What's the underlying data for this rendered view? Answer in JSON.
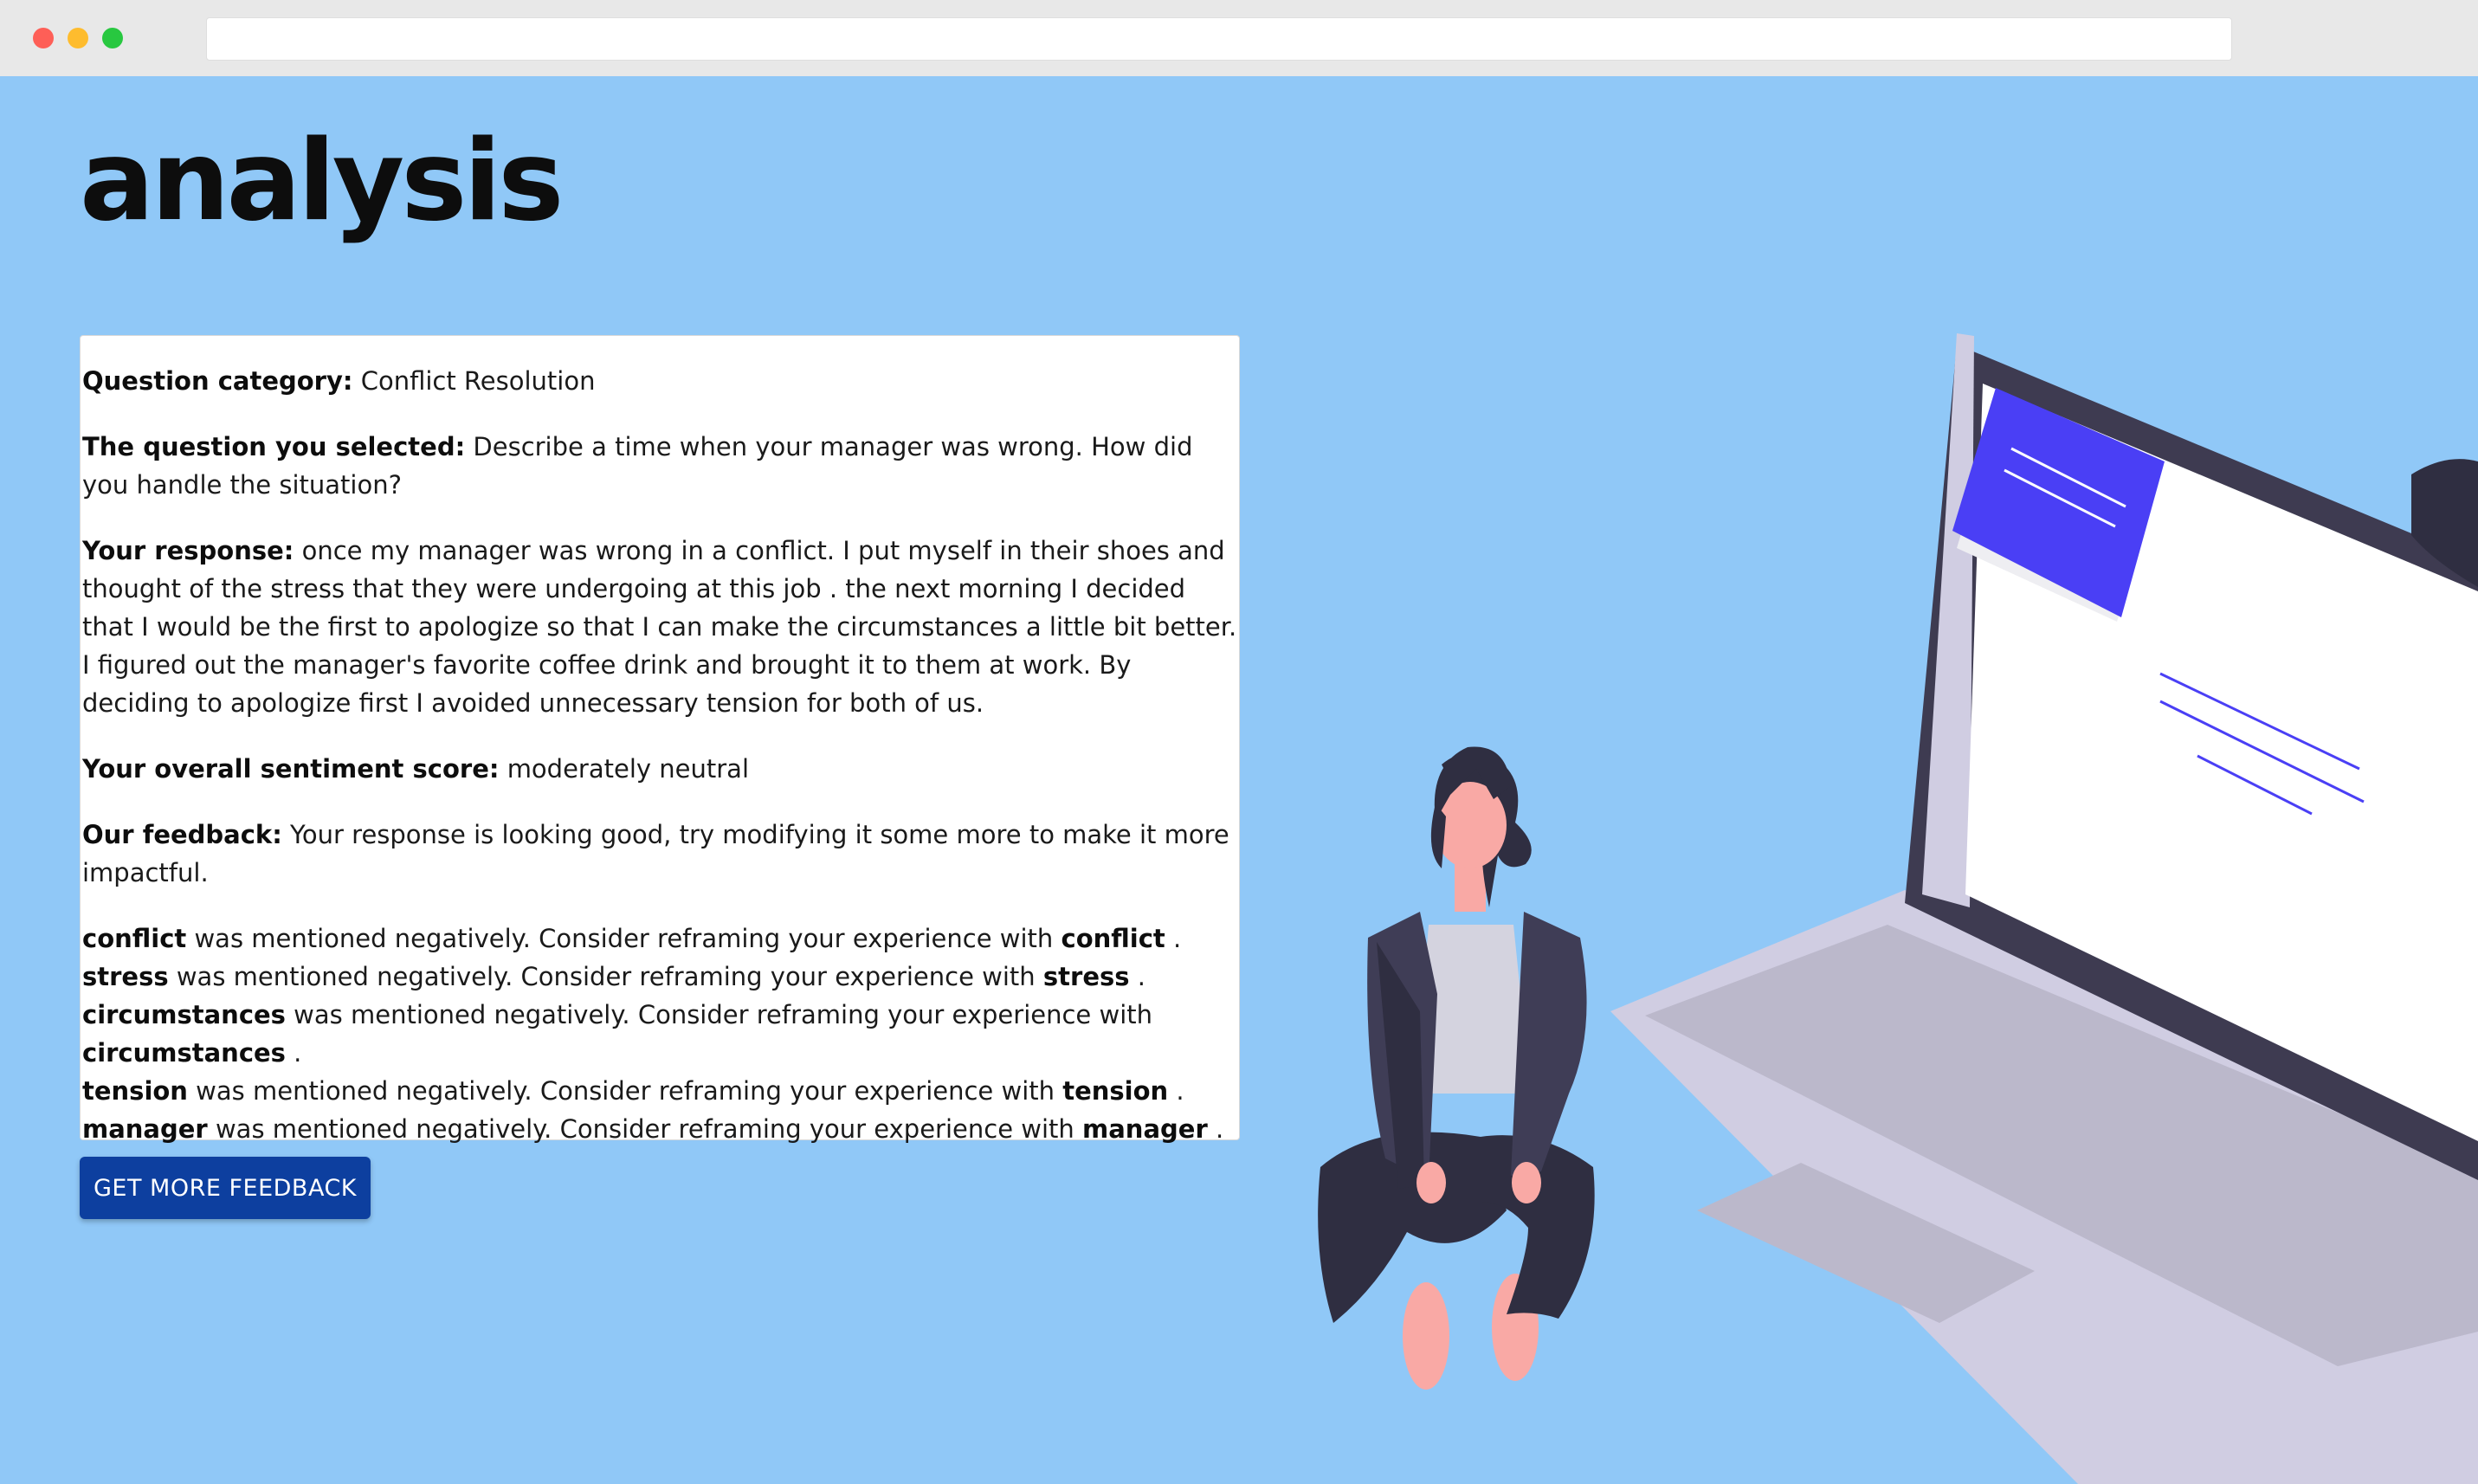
{
  "window": {
    "buttons": [
      "close",
      "minimize",
      "maximize"
    ],
    "url": ""
  },
  "page": {
    "title": "analysis",
    "background": "#90c8f7"
  },
  "analysis": {
    "category_label": "Question category:",
    "category_value": "Conflict Resolution",
    "question_label": "The question you selected:",
    "question_value": "Describe a time when your manager was wrong. How did you handle the situation?",
    "response_label": "Your response:",
    "response_value": "once my manager was wrong in a conflict. I put myself in their shoes and thought of the stress that they were undergoing at this job . the next morning I decided that I would be the first to apologize so that I can make the circumstances a little bit better. I figured out the manager's favorite coffee drink and brought it to them at work. By deciding to apologize first I avoided unnecessary tension for both of us.",
    "sentiment_label": "Your overall sentiment score:",
    "sentiment_value": "moderately neutral",
    "feedback_label": "Our feedback:",
    "feedback_value": "Your response is looking good, try modifying it some more to make it more impactful.",
    "issue_text": "was mentioned negatively. Consider reframing your experience with",
    "issues": [
      {
        "word": "conflict"
      },
      {
        "word": "stress"
      },
      {
        "word": "circumstances"
      },
      {
        "word": "tension"
      },
      {
        "word": "manager"
      }
    ]
  },
  "button": {
    "label": "GET MORE FEEDBACK",
    "color": "#0d3f9f"
  },
  "illustration": {
    "name": "woman-sitting-on-laptop",
    "accent": "#4a3ff5"
  }
}
